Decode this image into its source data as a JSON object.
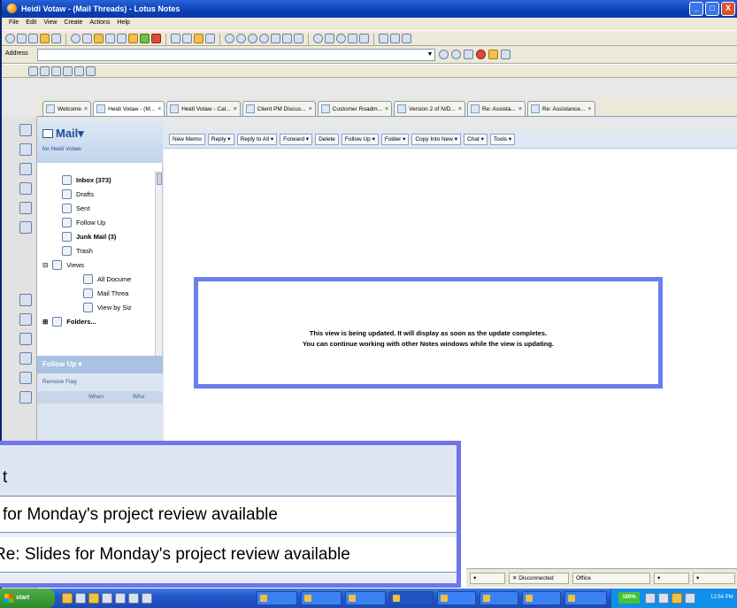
{
  "window": {
    "title": "Heidi Votaw - (Mail Threads) - Lotus Notes",
    "minimize": "_",
    "maximize": "□",
    "close": "X"
  },
  "menu": [
    "File",
    "Edit",
    "View",
    "Create",
    "Actions",
    "Help"
  ],
  "address": {
    "label": "Address",
    "value": "",
    "dropdown": "▼"
  },
  "tabs": [
    {
      "label": "Welcome",
      "close": "×"
    },
    {
      "label": "Heidi Votaw - (M...",
      "close": "×"
    },
    {
      "label": "Heidi Votaw - Cal...",
      "close": "×"
    },
    {
      "label": "Client PM Discus...",
      "close": "×"
    },
    {
      "label": "Customer Roadm...",
      "close": "×"
    },
    {
      "label": "Version 2 of N/D...",
      "close": "×"
    },
    {
      "label": "Re: Assista...",
      "close": "×"
    },
    {
      "label": "Re: Assistance...",
      "close": "×"
    }
  ],
  "navigator": {
    "title": "Mail",
    "title_arrow": "▾",
    "subtitle": "for Heidi Votaw",
    "folders": [
      {
        "label": "Inbox (373)",
        "bold": true,
        "icon": "inbox-icon"
      },
      {
        "label": "Drafts",
        "bold": false,
        "icon": "drafts-icon"
      },
      {
        "label": "Sent",
        "bold": false,
        "icon": "sent-icon"
      },
      {
        "label": "Follow Up",
        "bold": false,
        "icon": "follow-up-icon"
      },
      {
        "label": "Junk Mail (3)",
        "bold": true,
        "icon": "junk-mail-icon"
      },
      {
        "label": "Trash",
        "bold": false,
        "icon": "trash-icon"
      },
      {
        "label": "Views",
        "bold": false,
        "icon": "views-icon",
        "toggle": "⊟"
      },
      {
        "label": "All Docume",
        "bold": false,
        "icon": "document-icon"
      },
      {
        "label": "Mail Threa",
        "bold": false,
        "icon": "threads-icon"
      },
      {
        "label": "View by Siz",
        "bold": false,
        "icon": "view-size-icon"
      },
      {
        "label": "Folders...",
        "bold": true,
        "icon": "folder-icon",
        "toggle": "⊞"
      }
    ],
    "follow_up": {
      "title": "Follow Up ▾",
      "remove_flag": "Remove Flag",
      "col_when": "When",
      "col_who": "Who"
    }
  },
  "view_actions": [
    "New Memo",
    "Reply ▾",
    "Reply to All ▾",
    "Forward ▾",
    "Delete",
    "Follow Up ▾",
    "Folder ▾",
    "Copy Into New ▾",
    "Chat ▾",
    "Tools ▾"
  ],
  "update_message": {
    "line1": "This view is being updated.  It will display as soon as the update completes.",
    "line2": "You can continue working with other Notes windows while the view is updating."
  },
  "status": {
    "connection": "✕ Disconnected",
    "location": "Office"
  },
  "taskbar": {
    "start": "start",
    "battery": "100%",
    "clock": "12:54 PM"
  },
  "callout": {
    "header": "t",
    "row1": "for Monday's project review available",
    "row2": "Re: Slides for Monday's project review available"
  },
  "colors": {
    "accent": "#6a7ef0",
    "title_bar": "#0a3fb5",
    "nav_header": "#c2d4ec"
  }
}
